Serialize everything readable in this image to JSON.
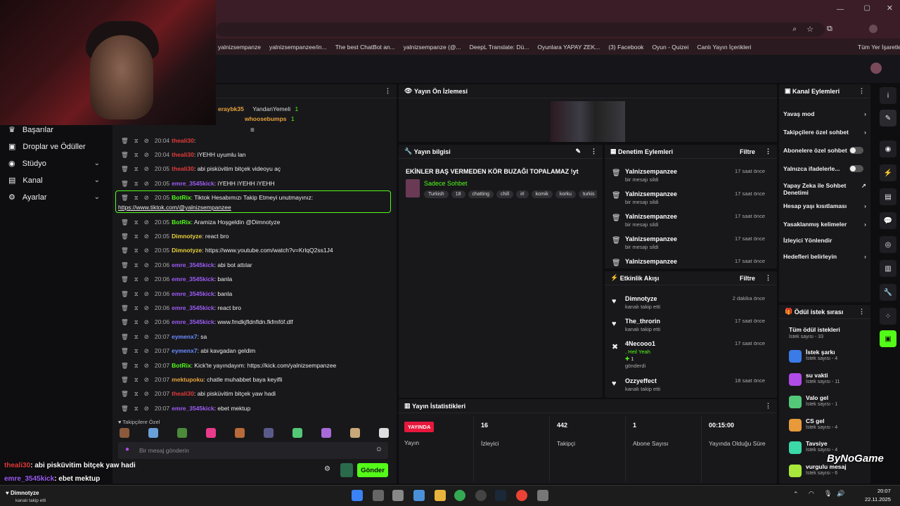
{
  "browser": {
    "bookmarks": [
      "yalnizsempanze",
      "yalnizsempanzee/in...",
      "The best ChatBot an...",
      "yalnizsempanze (@...",
      "DeepL Translate: Dü...",
      "Oyunlara YAPAY ZEK...",
      "(3) Facebook",
      "Oyun - Quizei",
      "Canlı Yayın İçerikleri"
    ],
    "all_bookmarks": "Tüm Yer İşaretleri"
  },
  "nav": {
    "items": [
      {
        "label": "Başarılar",
        "chev": ""
      },
      {
        "label": "Droplar ve Ödüller",
        "chev": ""
      },
      {
        "label": "Stüdyo",
        "chev": "⌄"
      },
      {
        "label": "Kanal",
        "chev": "⌄"
      },
      {
        "label": "Ayarlar",
        "chev": "⌄"
      }
    ]
  },
  "chat": {
    "top_users": [
      "eraybk35",
      "YandanYemeli",
      "1",
      "whoosebumps",
      "1"
    ],
    "lines": [
      {
        "time": "20:04",
        "user": "theali30",
        "cls": "u-red",
        "msg": ""
      },
      {
        "time": "20:04",
        "user": "theali30",
        "cls": "u-red",
        "msg": "iYEHH uyumlu lan"
      },
      {
        "time": "20:05",
        "user": "theali30",
        "cls": "u-red",
        "msg": "abi pisküvitim bitçek videoyu aç"
      },
      {
        "time": "20:05",
        "user": "emre_3545kick",
        "cls": "u-purple",
        "msg": "iYEHH iYEHH iYEHH"
      },
      {
        "time": "20:05",
        "user": "BotRix",
        "cls": "u-green",
        "msg": "Tiktok Hesabımızı Takip Etmeyi unutmayınız:"
      },
      {
        "time": "20:05",
        "user": "BotRix",
        "cls": "u-green",
        "msg": "Aramiza Hoşgeldin @Dimnotyze"
      },
      {
        "time": "20:05",
        "user": "Dimnotyze",
        "cls": "u-yellow",
        "msg": "react bro"
      },
      {
        "time": "20:05",
        "user": "Dimnotyze",
        "cls": "u-yellow",
        "msg": "https://www.youtube.com/watch?v=KrlqQ2ss1J4"
      },
      {
        "time": "20:06",
        "user": "emre_3545kick",
        "cls": "u-purple",
        "msg": "abi bot attılar"
      },
      {
        "time": "20:06",
        "user": "emre_3545kick",
        "cls": "u-purple",
        "msg": "banla"
      },
      {
        "time": "20:06",
        "user": "emre_3545kick",
        "cls": "u-purple",
        "msg": "banla"
      },
      {
        "time": "20:06",
        "user": "emre_3545kick",
        "cls": "u-purple",
        "msg": "react bro"
      },
      {
        "time": "20:06",
        "user": "emre_3545kick",
        "cls": "u-purple",
        "msg": "www.fmdkjfldnfldn.fkfmföf.dlf"
      },
      {
        "time": "20:07",
        "user": "eymenx7",
        "cls": "u-blue",
        "msg": "sa"
      },
      {
        "time": "20:07",
        "user": "eymenx7",
        "cls": "u-blue",
        "msg": "abi kavgadan geldim"
      },
      {
        "time": "20:07",
        "user": "BotRix",
        "cls": "u-green",
        "msg": "Kick'te yayındayım: https://kick.com/yalnizsempanzee"
      },
      {
        "time": "20:07",
        "user": "mektupoku",
        "cls": "u-orange",
        "msg": "chatle muhabbet baya keyifli"
      },
      {
        "time": "20:07",
        "user": "theali30",
        "cls": "u-red",
        "msg": "abi pisküvitim bitçek yaw hadi"
      },
      {
        "time": "20:07",
        "user": "emre_3545kick",
        "cls": "u-purple",
        "msg": "ebet mektup"
      }
    ],
    "bot_link": "https://www.tiktok.com/@yalnizsempanzee",
    "followers_label": "Takipçilere Özel",
    "input_placeholder": "Bir mesaj gönderin",
    "send_label": "Gönder"
  },
  "preview": {
    "title": "Yayın Ön İzlemesi"
  },
  "stream_info": {
    "header": "Yayın bilgisi",
    "title": "EKİNLER BAŞ VERMEDEN KÖR BUZAĞI TOPALAMAZ !yt",
    "category": "Sadece Sohbet",
    "tags": [
      "Turkish",
      "18",
      "chatting",
      "chill",
      "irl",
      "komik",
      "korku",
      "turkis"
    ]
  },
  "moderation": {
    "header": "Denetim Eylemleri",
    "filter": "Filtre",
    "rows": [
      {
        "name": "Yalnizsempanzee",
        "sub": "bir mesajı sildi",
        "time": "17 saat önce"
      },
      {
        "name": "Yalnizsempanzee",
        "sub": "bir mesajı sildi",
        "time": "17 saat önce"
      },
      {
        "name": "Yalnizsempanzee",
        "sub": "bir mesajı sildi",
        "time": "17 saat önce"
      },
      {
        "name": "Yalnizsempanzee",
        "sub": "bir mesajı sildi",
        "time": "17 saat önce"
      },
      {
        "name": "Yalnizsempanzee",
        "sub": "",
        "time": "17 saat önce"
      }
    ]
  },
  "activity": {
    "header": "Etkinlik Akışı",
    "filter": "Filtre",
    "rows": [
      {
        "name": "Dimnotyze",
        "sub": "kanalı takip etti",
        "time": "2 dakika önce"
      },
      {
        "name": "The_throrin",
        "sub": "kanalı takip etti",
        "time": "17 saat önce"
      },
      {
        "name": "4Necooo1",
        "sub": ", Heil Yeah",
        "extra": "1",
        "extra2": "gönderdi",
        "time": "17 saat önce"
      },
      {
        "name": "Ozzyeffect",
        "sub": "kanalı takip etti",
        "time": "18 saat önce"
      }
    ]
  },
  "channel_actions": {
    "header": "Kanal Eylemleri",
    "items": [
      "Yavaş mod",
      "Takipçilere özel sohbet",
      "Abonelere özel sohbet",
      "Yalnızca ifadelerle...",
      "Yapay Zeka ile Sohbet Denetimi",
      "Hesap yaşı kısıtlaması",
      "Yasaklanmış kelimeler",
      "İzleyici Yönlendir",
      "Hedefleri belirleyin"
    ]
  },
  "rewards": {
    "header": "Ödül istek sırası",
    "all": "Tüm ödül istekleri",
    "all_sub": "İstek sayısı - 33",
    "items": [
      {
        "name": "İstek şarkı",
        "sub": "İstek sayısı - 4",
        "color": "#3b7be8"
      },
      {
        "name": "su vakti",
        "sub": "İstek sayısı - 11",
        "color": "#b04be8"
      },
      {
        "name": "Valo gel",
        "sub": "İstek sayısı - 1",
        "color": "#53c878"
      },
      {
        "name": "CS gel",
        "sub": "İstek sayısı - 4",
        "color": "#e89a3b"
      },
      {
        "name": "Tavsiye",
        "sub": "İstek sayısı - 4",
        "color": "#3bd8a8"
      },
      {
        "name": "vurgulu mesaj",
        "sub": "İstek sayısı - 6",
        "color": "#a8e83b"
      }
    ]
  },
  "stats": {
    "header": "Yayın İstatistikleri",
    "live": "YAYINDA",
    "live_label": "Yayın",
    "cells": [
      {
        "val": "16",
        "lab": "İzleyici"
      },
      {
        "val": "442",
        "lab": "Takipçi"
      },
      {
        "val": "1",
        "lab": "Abone Sayısı"
      },
      {
        "val": "00:15:00",
        "lab": "Yayında Olduğu Süre"
      }
    ]
  },
  "overlay": {
    "line1_user": "theali30",
    "line1_msg": ": abi pisküvitim bitçek yaw hadi",
    "line2_user": "emre_3545kick",
    "line2_msg": ": ebet mektup",
    "notif_name": "Dimnotyze",
    "notif_sub": "kanalı takip etti",
    "watermark": "ByNoGame"
  },
  "taskbar": {
    "time": "20:07",
    "date": "22.11.2025"
  }
}
